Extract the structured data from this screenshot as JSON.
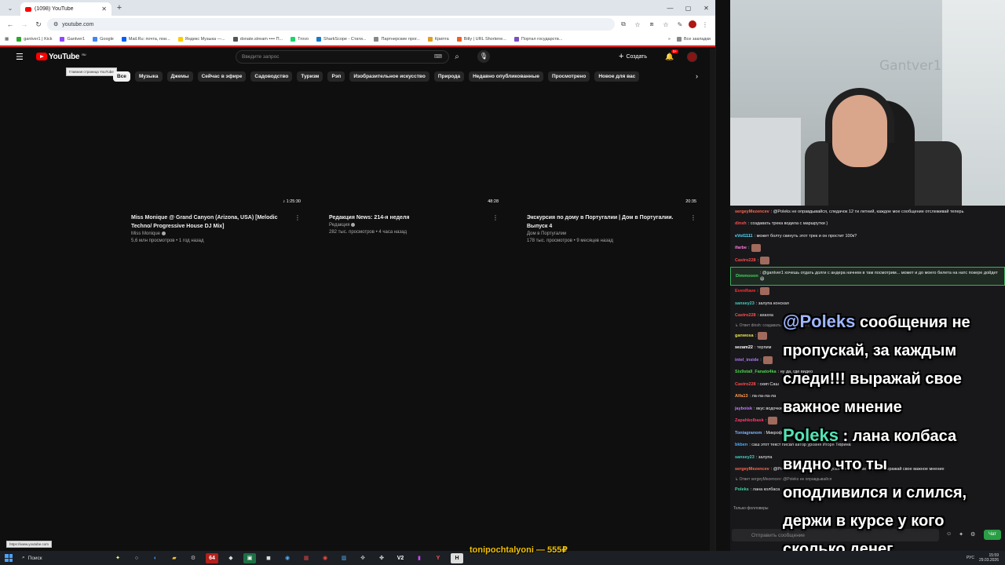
{
  "browser": {
    "tab_title": "(1098) YouTube",
    "url": "youtube.com",
    "window_controls": [
      "—",
      "▢",
      "✕"
    ],
    "bookmarks": [
      {
        "label": "gantver1 | Kick",
        "color": "#2ca82c"
      },
      {
        "label": "Gantver1",
        "color": "#9146ff"
      },
      {
        "label": "Google",
        "color": "#4285f4"
      },
      {
        "label": "Mail.Ru: почта, пои...",
        "color": "#005ff9"
      },
      {
        "label": "Яндекс Музыка —...",
        "color": "#ffcc00"
      },
      {
        "label": "donate.stream •••• П...",
        "color": "#555555"
      },
      {
        "label": "Trovo",
        "color": "#19d66b"
      },
      {
        "label": "SharkScope - Стати...",
        "color": "#1a7ac9"
      },
      {
        "label": "Партнерские прог...",
        "color": "#888888"
      },
      {
        "label": "Крипта",
        "color": "#e0a020"
      },
      {
        "label": "Bitly | URL Shortene...",
        "color": "#ee6123"
      },
      {
        "label": "Портал государств...",
        "color": "#7b4ec0"
      }
    ],
    "bookmarks_more": "»",
    "bookmarks_all": "Все закладки",
    "status_url": "https://www.youtube.com"
  },
  "youtube": {
    "logo_text": "YouTube",
    "logo_region": "RU",
    "tooltip": "Главная страница YouTube",
    "search_placeholder": "Введите запрос",
    "create_label": "Создать",
    "notifications_count": "9+",
    "chips": [
      "Все",
      "Музыка",
      "Джемы",
      "Сейчас в эфире",
      "Садоводство",
      "Туризм",
      "Рэп",
      "Изобразительное искусство",
      "Природа",
      "Недавно опубликованные",
      "Просмотрено",
      "Новое для вас"
    ],
    "active_chip": "Все",
    "videos": [
      {
        "duration": "♪ 1:25:30",
        "title": "Miss Monique @ Grand Canyon (Arizona, USA) [Melodic Techno/ Progressive House DJ Mix]",
        "channel": "Miss Monique",
        "meta": "5,6 млн просмотров • 1 год назад"
      },
      {
        "duration": "48:28",
        "title": "Редакция News: 214-я неделя",
        "channel": "Редакция",
        "meta": "282 тыс. просмотров • 4 часа назад"
      },
      {
        "duration": "20:35",
        "title": "Экскурсия по дому в Португалии | Дом в Португалии. Выпуск 4",
        "channel": "Дом в Португалии",
        "meta": "178 тыс. просмотров • 9 месяцев назад"
      }
    ]
  },
  "webcam": {
    "watermark": "Gantver1"
  },
  "chat": {
    "messages": [
      {
        "user": "sergeyMezencev",
        "color": "#ff6a4d",
        "text": ": @Poleks не оправдывайся, следачок 12 ти летний, каждое мое сообщение отслеживай теперь"
      },
      {
        "user": "dinsh",
        "color": "#ff4d4d",
        "text": ": создавать трека водила с маршрутки )"
      },
      {
        "user": "eVol1111",
        "color": "#4de0ff",
        "text": ": может болту скинуть этот трек и он простит 100к?"
      },
      {
        "user": "ifarbe",
        "color": "#ff7ad9",
        "text": ":"
      },
      {
        "user": "Castro228",
        "color": "#ff4d4d",
        "text": ":"
      },
      {
        "user": "Dimmooon",
        "color": "#3fd35a",
        "text": ": @gantver1 хочешь отдать долги с андера начнем в там посмотрим... может и до моего билета на натс покере дойдет 😄",
        "highlight": true
      },
      {
        "user": "EvenRave",
        "color": "#ff3333",
        "text": ":"
      },
      {
        "user": "sansey23",
        "color": "#3fd3c0",
        "text": ": залупа конская"
      },
      {
        "user": "Castro228",
        "color": "#ff4d4d",
        "text": ": ахахха"
      },
      {
        "user": "",
        "color": "#999999",
        "text": "↳ Ответ dinsh: создавать трека водила с маршрутки )",
        "reply": true
      },
      {
        "user": "ganwosa",
        "color": "#e6e24d",
        "text": ":"
      },
      {
        "user": "sezam22",
        "color": "#ffffff",
        "text": ": терпим"
      },
      {
        "user": "intel_inside",
        "color": "#b07aff",
        "text": ":"
      },
      {
        "user": "Sis9sta9_Fanato4ka",
        "color": "#4dd34d",
        "text": ": ну да, где видео"
      },
      {
        "user": "Castro228",
        "color": "#ff4d4d",
        "text": ": скип Саш"
      },
      {
        "user": "Alfa13",
        "color": "#ff9a4d",
        "text": ": ла-ла-ла-ла"
      },
      {
        "user": "jayboisk",
        "color": "#c47aff",
        "text": ": вкус водочки связан с ума"
      },
      {
        "user": "Zapahkolbask",
        "color": "#ff3b6b",
        "text": ":"
      },
      {
        "user": "Toniagranom",
        "color": "#7ab5ff",
        "text": ": Микрофон"
      },
      {
        "user": "bkben",
        "color": "#4dafff",
        "text": ": саш этот текст писал автор уровня Игоря Тюрина"
      },
      {
        "user": "sansey23",
        "color": "#3fd3c0",
        "text": ": залупа"
      },
      {
        "user": "sergeyMezencev",
        "color": "#ff6a4d",
        "text": ": @Poleks сообщения не пропускай, за каждым следи!!! выражай свое важное мнение"
      },
      {
        "user": "",
        "color": "#999999",
        "text": "↳ Ответ sergeyMezencev: @Poleks не оправдывайся",
        "reply": true
      },
      {
        "user": "Poleks",
        "color": "#3fd3a0",
        "text": ": лана колбаса"
      }
    ],
    "followers_only": "Только фолловеры",
    "input_placeholder": "Отправить сообщение",
    "send_label": "Чат"
  },
  "overlay": {
    "line1_mention": "@Poleks",
    "line1_rest": " сообщения не",
    "line2": "пропускай, за каждым",
    "line3": "следи!!! выражай свое",
    "line4": "важное мнение",
    "line5_name": "Poleks",
    "line5_rest": " : лана колбаса",
    "line6": "видно что ты",
    "line7": "оподливился и слился,",
    "line8": "держи в курсе у кого",
    "line9": "сколько денег"
  },
  "taskbar": {
    "search_label": "Поиск",
    "marquee": "tonipochtalyoni — 555₽",
    "lang": "РУС",
    "time": "15:59",
    "date": "29.03.2026"
  }
}
